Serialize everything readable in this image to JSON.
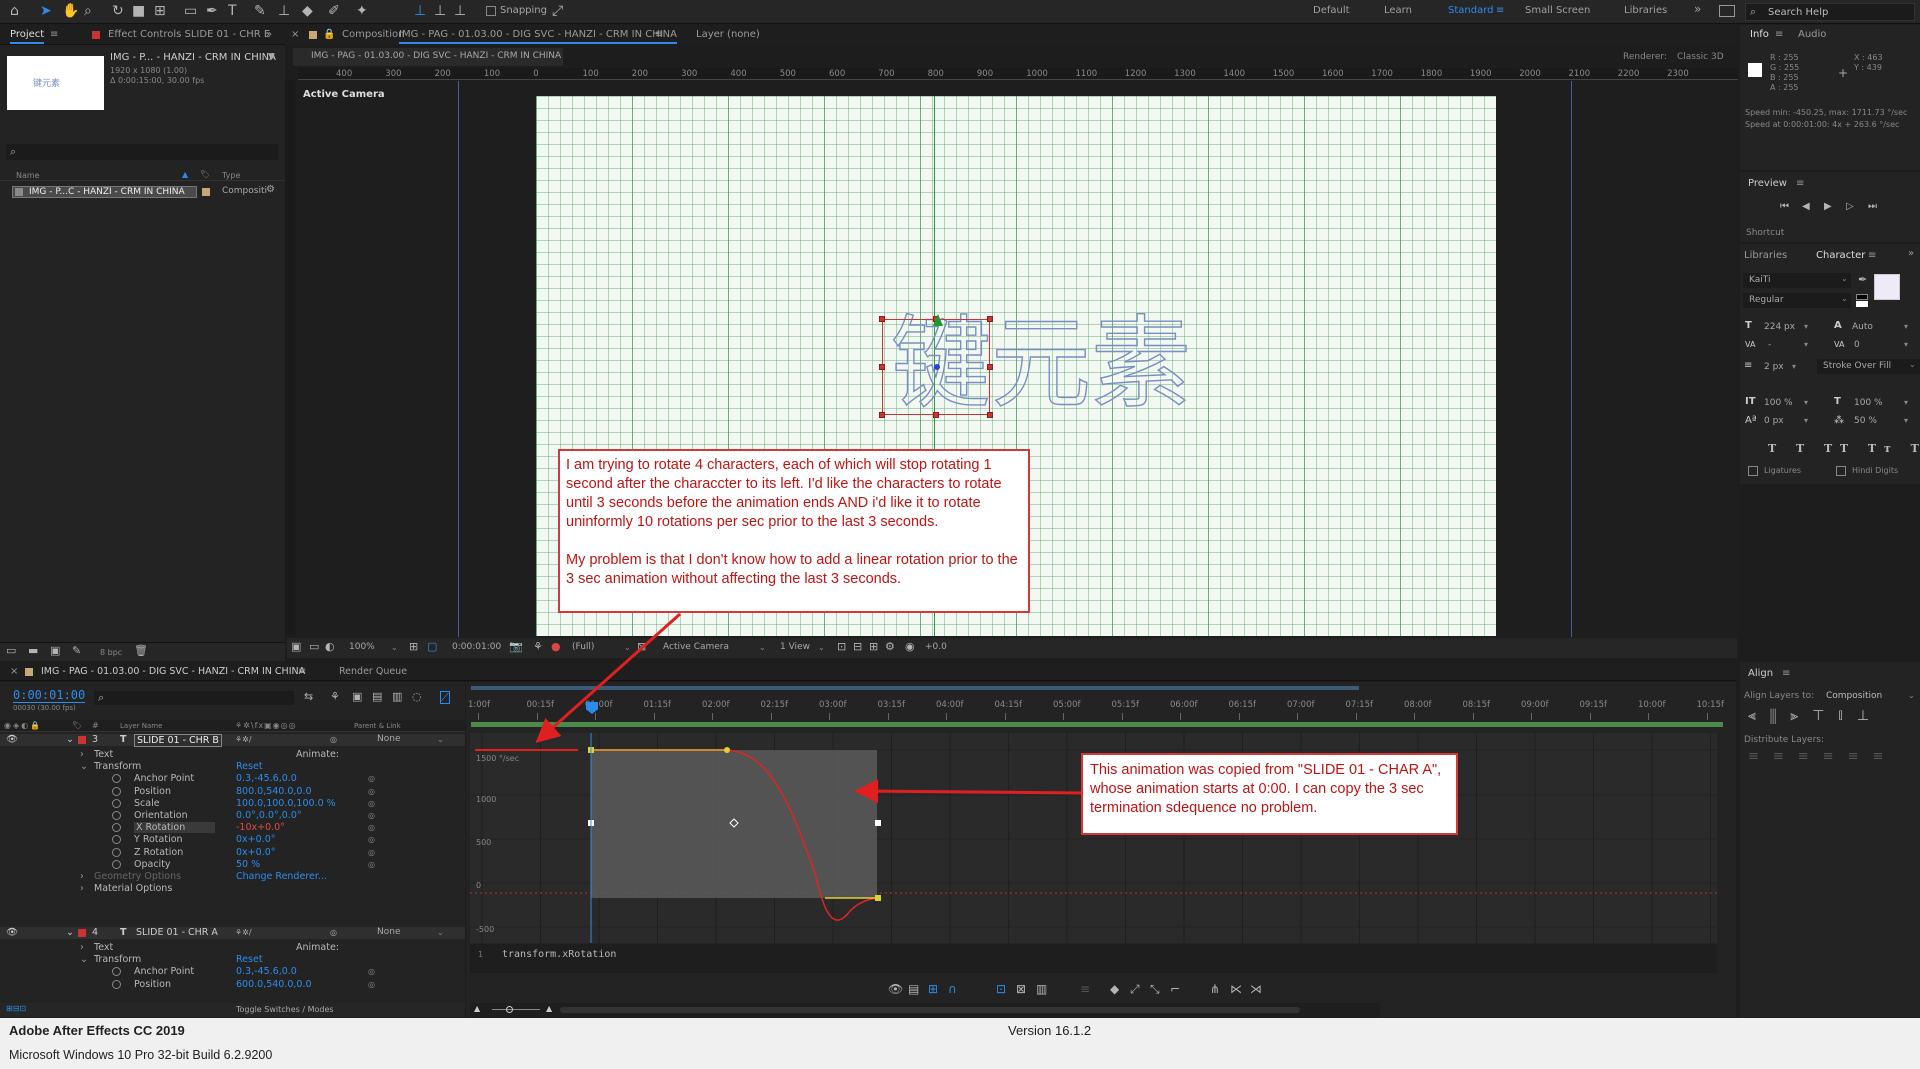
{
  "toolbar": {
    "snapping_label": "Snapping",
    "workspaces": [
      "Default",
      "Learn",
      "Standard",
      "Small Screen",
      "Libraries"
    ],
    "active_workspace": "Standard",
    "search_placeholder": "Search Help"
  },
  "project_panel": {
    "tab_project": "Project",
    "tab_effect_controls": "Effect Controls SLIDE 01 - CHR E",
    "item_title": "IMG - P... - HANZI - CRM IN CHINA",
    "item_size": "1920 x 1080 (1.00)",
    "item_duration": "Δ 0:00:15:00, 30.00 fps",
    "col_name": "Name",
    "col_type": "Type",
    "row_name": "IMG - P...C - HANZI - CRM IN CHINA",
    "row_type": "Compositi",
    "bpc": "8 bpc"
  },
  "comp_panel": {
    "tab_label": "Composition",
    "tab_comp_name": "IMG - PAG - 01.03.00 - DIG SVC - HANZI - CRM IN CHINA",
    "layer_label": "Layer (none)",
    "breadcrumb": "IMG - PAG - 01.03.00 - DIG SVC - HANZI - CRM IN CHINA",
    "renderer_label": "Renderer:",
    "renderer_value": "Classic 3D",
    "active_camera": "Active Camera",
    "ruler_ticks": [
      "400",
      "300",
      "200",
      "100",
      "0",
      "100",
      "200",
      "300",
      "400",
      "500",
      "600",
      "700",
      "800",
      "900",
      "1000",
      "1100",
      "1200",
      "1300",
      "1400",
      "1500",
      "1600",
      "1700",
      "1800",
      "1900",
      "2000",
      "2100",
      "2200",
      "2300"
    ],
    "chars": [
      "键",
      "元",
      "素"
    ],
    "zoom": "100%",
    "timecode": "0:00:01:00",
    "resolution": "(Full)",
    "camera_select": "Active Camera",
    "view_select": "1 View",
    "exposure": "+0.0"
  },
  "callout_top": {
    "paragraph1": "I am trying to rotate 4 characters, each of which will stop rotating 1 second after the characcter to its left. I'd like the characters to rotate until 3 seconds before the animation ends AND i'd like it to rotate uninformly 10 rotations per sec prior to the last 3 seconds.",
    "paragraph2": "My problem is that I don't know how to add a linear rotation prior to the 3 sec animation without affecting the last 3 seconds."
  },
  "callout_bottom": {
    "text": "This animation was copied from \"SLIDE 01 - CHAR A\", whose animation starts at 0:00. I can copy the 3 sec termination sdequence no problem."
  },
  "info_panel": {
    "tab_info": "Info",
    "tab_audio": "Audio",
    "r": "R : 255",
    "g": "G : 255",
    "b": "B : 255",
    "a": "A : 255",
    "x": "X : 463",
    "y": "Y : 439",
    "speed1": "Speed min: -450.25, max: 1711.73 °/sec",
    "speed2": "Speed at 0:00:01:00: 4x + 263.6 °/sec"
  },
  "preview_panel": {
    "title": "Preview",
    "shortcut": "Shortcut"
  },
  "character_panel": {
    "tab_libraries": "Libraries",
    "tab_character": "Character",
    "font": "KaiTi",
    "style": "Regular",
    "size": "224 px",
    "leading": "Auto",
    "kerning": "-",
    "tracking": "0",
    "stroke_width": "2 px",
    "stroke_mode": "Stroke Over Fill",
    "vscale": "100 %",
    "hscale": "100 %",
    "baseline": "0 px",
    "tsume": "50 %",
    "ligatures": "Ligatures",
    "hindi_digits": "Hindi Digits"
  },
  "align_panel": {
    "title": "Align",
    "align_to_label": "Align Layers to:",
    "align_to_value": "Composition",
    "distribute": "Distribute Layers:"
  },
  "timeline": {
    "tab_comp": "IMG - PAG - 01.03.00 - DIG SVC - HANZI - CRM IN CHINA",
    "tab_render_queue": "Render Queue",
    "current_time": "0:00:01:00",
    "current_frames": "00030 (30.00 fps)",
    "col_layer_name": "Layer Name",
    "col_parent": "Parent & Link",
    "ruler": [
      "1:00f",
      "00:15f",
      "01:00f",
      "01:15f",
      "02:00f",
      "02:15f",
      "03:00f",
      "03:15f",
      "04:00f",
      "04:15f",
      "05:00f",
      "05:15f",
      "06:00f",
      "06:15f",
      "07:00f",
      "07:15f",
      "08:00f",
      "08:15f",
      "09:00f",
      "09:15f",
      "10:00f",
      "10:15f"
    ],
    "graph_labels": [
      "1500 °/sec",
      "1000",
      "500",
      "0",
      "-500"
    ],
    "expression": "transform.xRotation",
    "toggle_label": "Toggle Switches / Modes",
    "layers": [
      {
        "num": "3",
        "name": "SLIDE 01 - CHR B",
        "parent": "None"
      },
      {
        "num": "4",
        "name": "SLIDE 01 - CHR A",
        "parent": "None"
      }
    ],
    "rows_a": [
      {
        "label": "Text",
        "value": "",
        "extra": "Animate:"
      },
      {
        "label": "Transform",
        "value": "Reset",
        "extra": ""
      },
      {
        "label": "Anchor Point",
        "value": "0.3,-45.6,0.0",
        "extra": ""
      },
      {
        "label": "Position",
        "value": "800.0,540.0,0.0",
        "extra": ""
      },
      {
        "label": "Scale",
        "value": "100.0,100.0,100.0 %",
        "extra": ""
      },
      {
        "label": "Orientation",
        "value": "0.0°,0.0°,0.0°",
        "extra": ""
      },
      {
        "label": "X Rotation",
        "value": "-10x+0.0°",
        "extra": ""
      },
      {
        "label": "Y Rotation",
        "value": "0x+0.0°",
        "extra": ""
      },
      {
        "label": "Z Rotation",
        "value": "0x+0.0°",
        "extra": ""
      },
      {
        "label": "Opacity",
        "value": "50 %",
        "extra": ""
      },
      {
        "label": "Geometry Options",
        "value": "Change Renderer...",
        "extra": ""
      },
      {
        "label": "Material Options",
        "value": "",
        "extra": ""
      }
    ],
    "rows_b": [
      {
        "label": "Text",
        "value": "",
        "extra": "Animate:"
      },
      {
        "label": "Transform",
        "value": "Reset",
        "extra": ""
      },
      {
        "label": "Anchor Point",
        "value": "0.3,-45.6,0.0",
        "extra": ""
      },
      {
        "label": "Position",
        "value": "600.0,540.0,0.0",
        "extra": ""
      }
    ]
  },
  "status_bar": {
    "app": "Adobe After Effects CC 2019",
    "version": "Version 16.1.2",
    "os": "Microsoft Windows 10 Pro 32-bit Build 6.2.9200"
  }
}
